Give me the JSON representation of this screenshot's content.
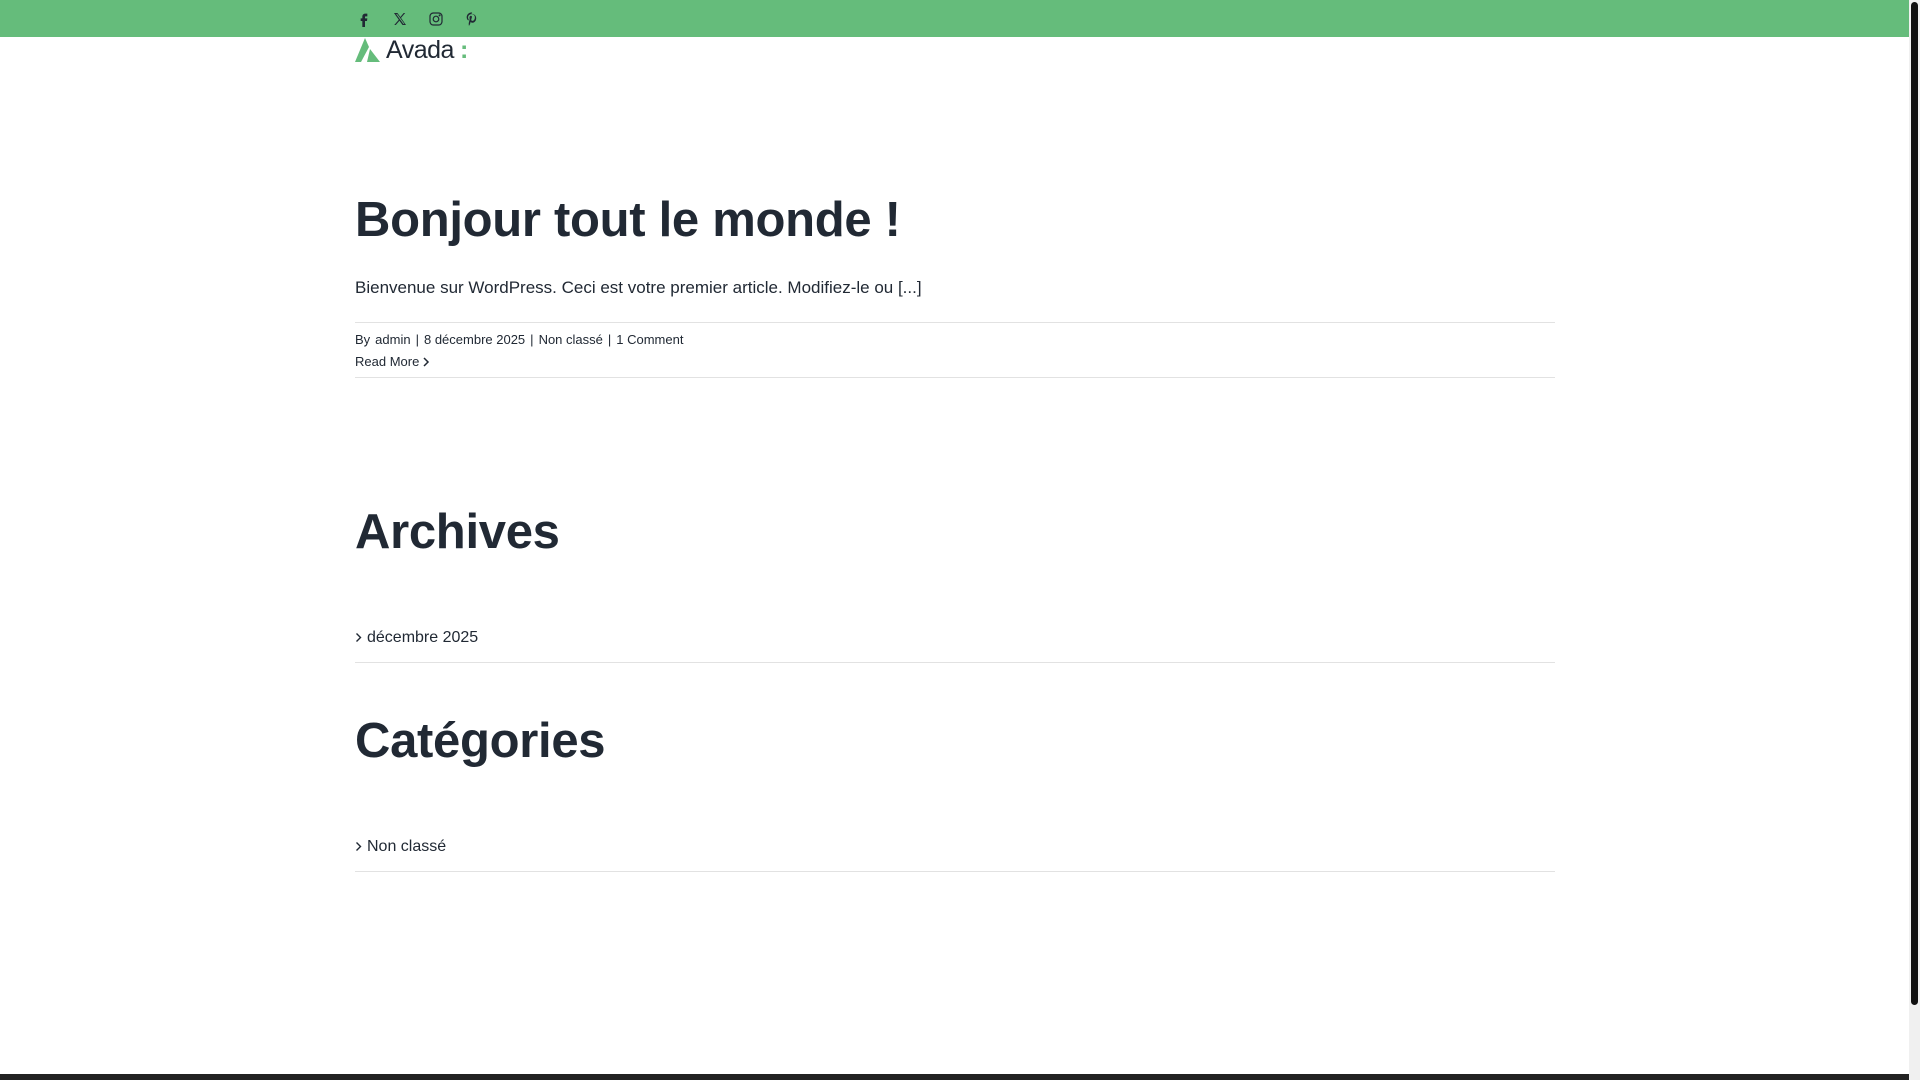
{
  "topbar": {
    "color": "#65bc7b",
    "social_icons": [
      "facebook-icon",
      "x-twitter-icon",
      "instagram-icon",
      "pinterest-icon"
    ]
  },
  "logo": {
    "text": "Avada",
    "dots": ":"
  },
  "post": {
    "title": "Bonjour tout le monde !",
    "excerpt": "Bienvenue sur WordPress. Ceci est votre premier article. Modifiez-le ou [...]",
    "meta": {
      "by_label": "By",
      "author": "admin",
      "date": "8 décembre 2025",
      "category": "Non classé",
      "comments": "1 Comment",
      "separator": "|"
    },
    "read_more": "Read More"
  },
  "archives": {
    "title": "Archives",
    "items": [
      "décembre 2025"
    ]
  },
  "categories": {
    "title": "Catégories",
    "items": [
      "Non classé"
    ]
  }
}
